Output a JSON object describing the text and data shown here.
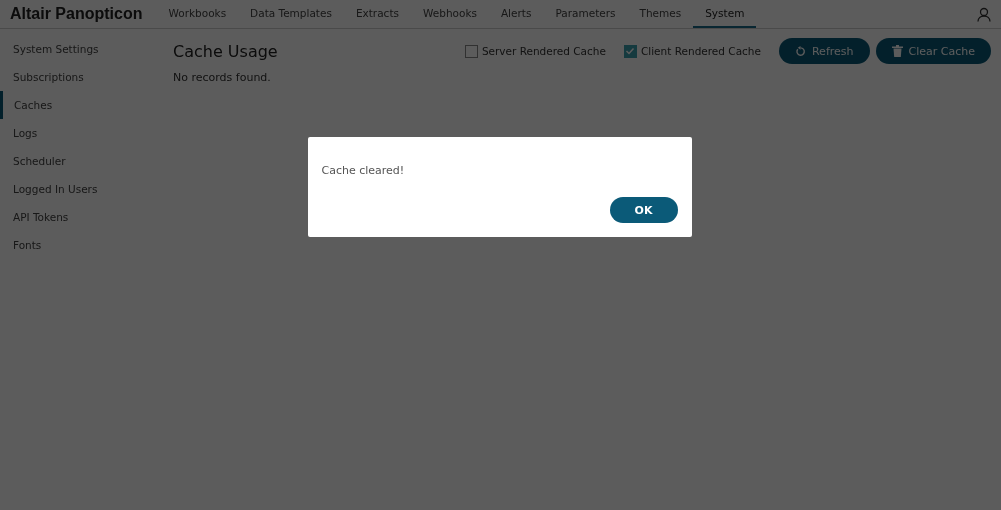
{
  "brand": "Altair Panopticon",
  "tabs": [
    {
      "label": "Workbooks",
      "selected": false
    },
    {
      "label": "Data Templates",
      "selected": false
    },
    {
      "label": "Extracts",
      "selected": false
    },
    {
      "label": "Webhooks",
      "selected": false
    },
    {
      "label": "Alerts",
      "selected": false
    },
    {
      "label": "Parameters",
      "selected": false
    },
    {
      "label": "Themes",
      "selected": false
    },
    {
      "label": "System",
      "selected": true
    }
  ],
  "sidebar": {
    "items": [
      {
        "label": "System Settings",
        "selected": false
      },
      {
        "label": "Subscriptions",
        "selected": false
      },
      {
        "label": "Caches",
        "selected": true
      },
      {
        "label": "Logs",
        "selected": false
      },
      {
        "label": "Scheduler",
        "selected": false
      },
      {
        "label": "Logged In Users",
        "selected": false
      },
      {
        "label": "API Tokens",
        "selected": false
      },
      {
        "label": "Fonts",
        "selected": false
      }
    ]
  },
  "content": {
    "title": "Cache Usage",
    "empty_message": "No records found.",
    "filters": [
      {
        "label": "Server Rendered Cache",
        "checked": false
      },
      {
        "label": "Client Rendered Cache",
        "checked": true
      }
    ],
    "buttons": [
      {
        "kind": "refresh",
        "label": "Refresh"
      },
      {
        "kind": "clear",
        "label": "Clear Cache"
      }
    ]
  },
  "dialog": {
    "message": "Cache cleared!",
    "button": "OK"
  }
}
